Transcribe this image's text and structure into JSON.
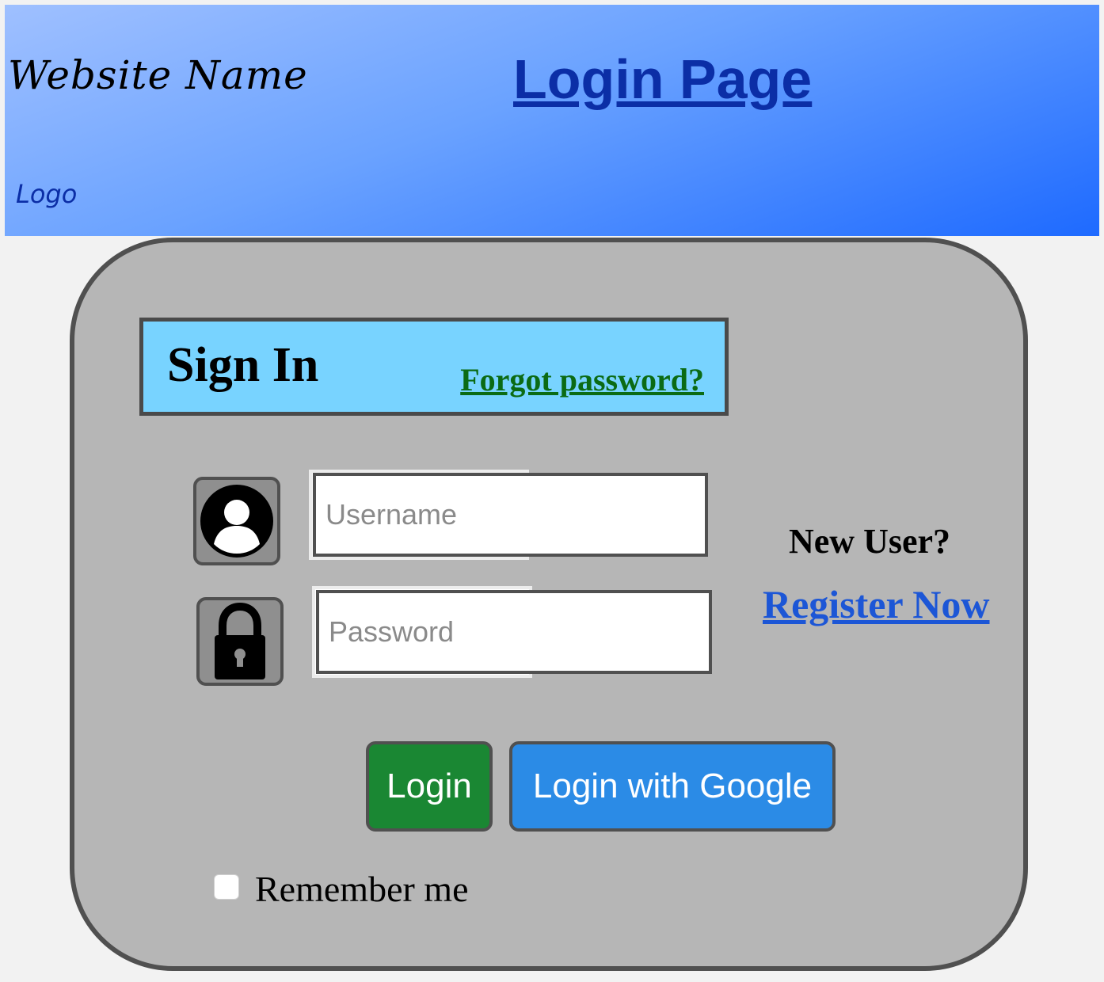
{
  "header": {
    "site_name": "Website Name",
    "page_title": "Login Page",
    "logo_label": "Logo"
  },
  "signin": {
    "title": "Sign In",
    "forgot_password": "Forgot password?"
  },
  "form": {
    "username_placeholder": "Username",
    "username_value": "",
    "password_placeholder": "Password",
    "password_value": "",
    "user_icon": "user-avatar-icon",
    "lock_icon": "padlock-icon"
  },
  "register": {
    "prompt": "New User?",
    "link": "Register Now"
  },
  "actions": {
    "login_label": "Login",
    "google_label": "Login with Google"
  },
  "remember": {
    "label": "Remember me",
    "checked": false
  },
  "colors": {
    "header_gradient_start": "#9fc0ff",
    "header_gradient_end": "#1e6aff",
    "card_bg": "#b6b6b6",
    "signin_bar_bg": "#78d3ff",
    "forgot_link": "#0b6b14",
    "register_link": "#1c56d6",
    "login_button": "#1a8733",
    "google_button": "#2b8be6"
  }
}
